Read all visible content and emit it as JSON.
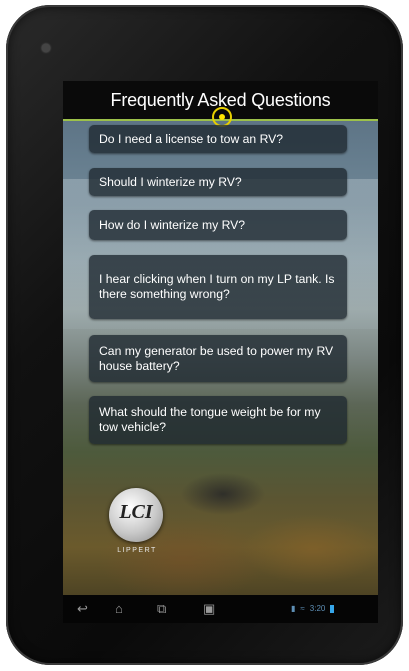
{
  "header": {
    "title": "Frequently Asked Questions"
  },
  "faq": [
    {
      "label": "Do I need a license to tow an RV?"
    },
    {
      "label": "Should I winterize my RV?"
    },
    {
      "label": "How do I winterize my RV?"
    },
    {
      "label": "I hear clicking when I turn on my LP tank.  Is there something wrong?"
    },
    {
      "label": "Can my generator be used to power my RV house battery?"
    },
    {
      "label": "What should the tongue weight be for my tow vehicle?"
    }
  ],
  "brand": {
    "logo_mark": "LCI",
    "logo_text": "LIPPERT"
  },
  "colors": {
    "accent": "#9cc14a",
    "touch": "#ffe600",
    "card_bg": "#1e2830"
  },
  "navbar": {
    "icons": [
      "back-icon",
      "home-icon",
      "recent-apps-icon",
      "screenshot-icon"
    ],
    "status_text": "3:20"
  }
}
